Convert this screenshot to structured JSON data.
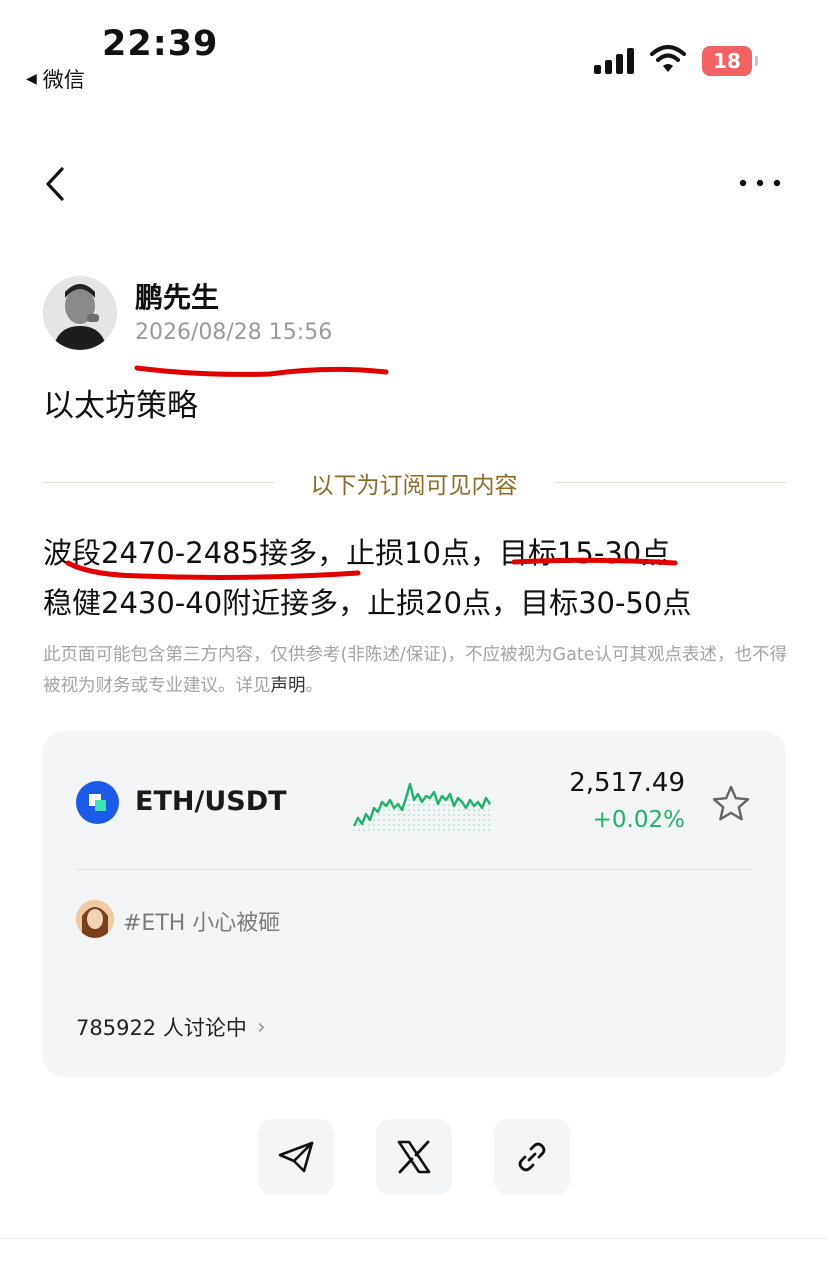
{
  "status_bar": {
    "time": "22:39",
    "back_app": "微信",
    "battery": "18"
  },
  "author": {
    "name": "鹏先生",
    "timestamp": "2026/08/28 15:56"
  },
  "post": {
    "title": "以太坊策略",
    "subscription_label": "以下为订阅可见内容",
    "lines": [
      "波段2470-2485接多，止损10点，目标15-30点",
      "稳健2430-40附近接多，止损20点，目标30-50点"
    ],
    "disclaimer": "此页面可能包含第三方内容，仅供参考(非陈述/保证)，不应被视为Gate认可其观点表述，也不得被视为财务或专业建议。详见",
    "disclaimer_link": "声明",
    "disclaimer_end": "。"
  },
  "market_card": {
    "pair": "ETH/USDT",
    "price": "2,517.49",
    "change": "+0.02%",
    "tag": "#ETH 小心被砸",
    "discussion": "785922 人讨论中",
    "colors": {
      "up": "#20b26c",
      "coin": "#1c5ae8",
      "annotation": "#e00000"
    }
  },
  "share": {
    "buttons": [
      "telegram-icon",
      "x-icon",
      "link-icon"
    ]
  }
}
